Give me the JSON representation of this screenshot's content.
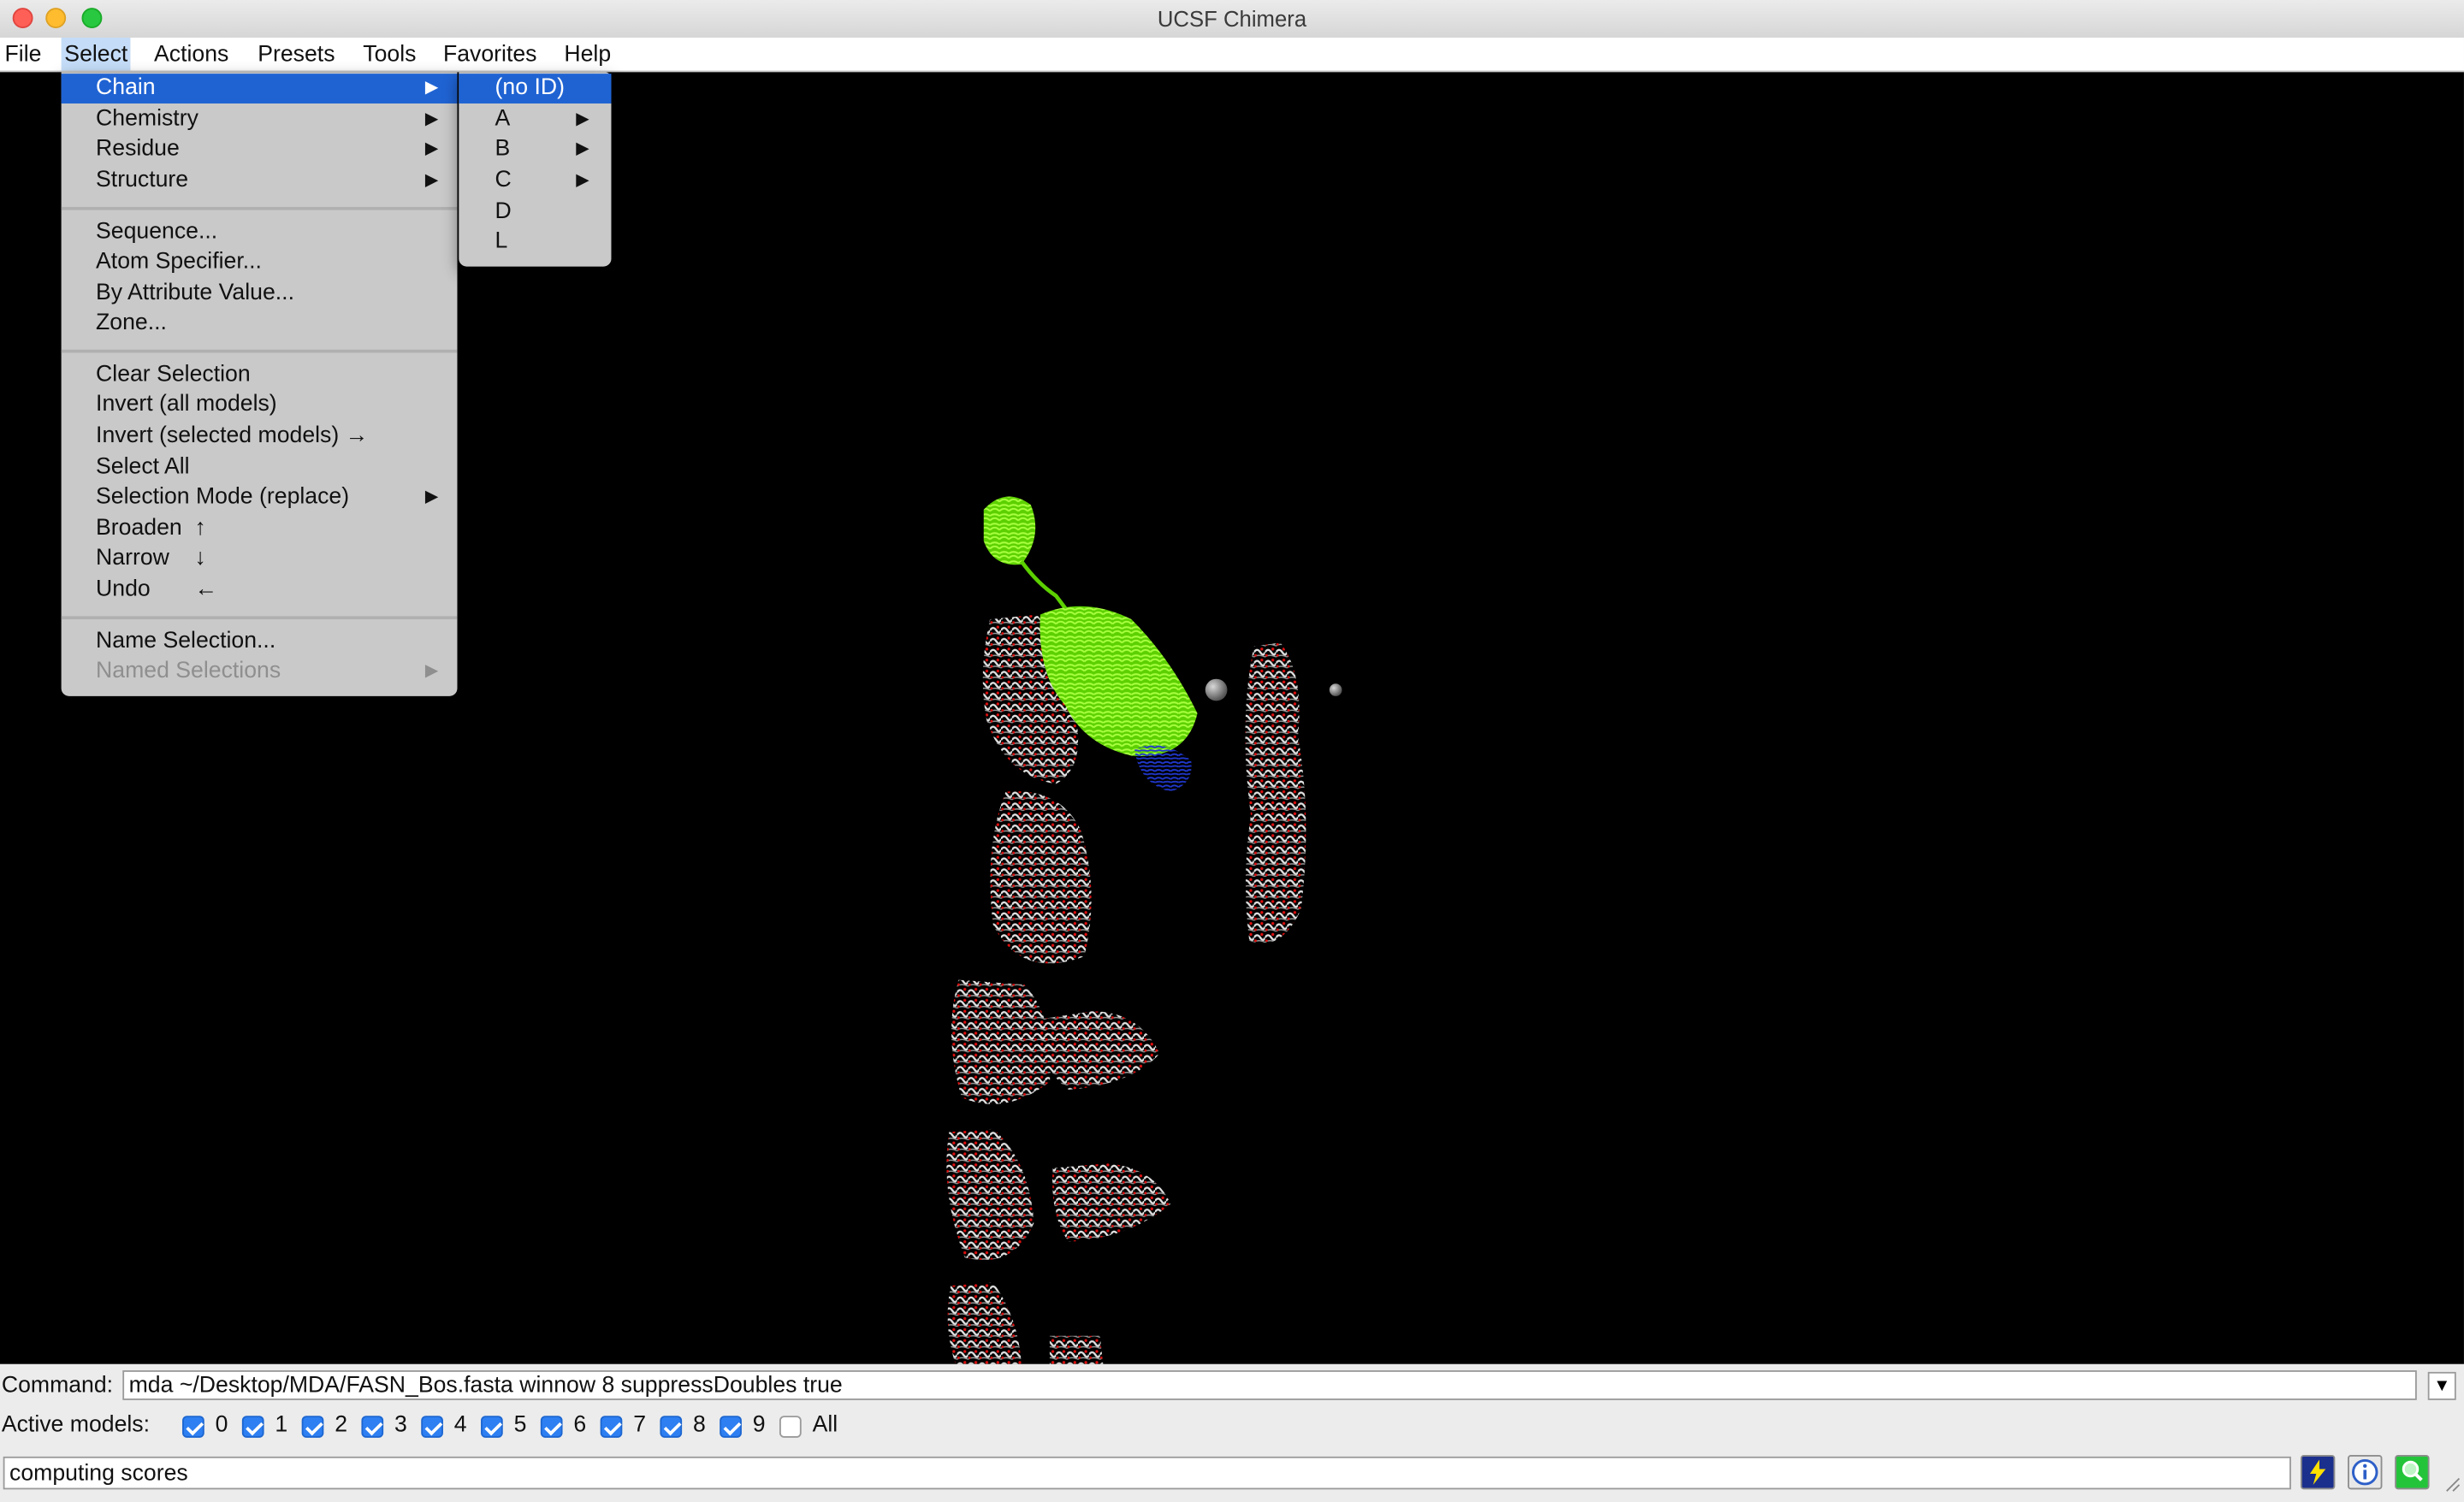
{
  "window": {
    "title": "UCSF Chimera"
  },
  "menubar": {
    "items": [
      "File",
      "Select",
      "Actions",
      "Presets",
      "Tools",
      "Favorites",
      "Help"
    ],
    "active": "Select"
  },
  "select_menu": {
    "items": [
      {
        "label": "Chain",
        "submenu": true,
        "highlighted": true
      },
      {
        "label": "Chemistry",
        "submenu": true
      },
      {
        "label": "Residue",
        "submenu": true
      },
      {
        "label": "Structure",
        "submenu": true
      },
      {
        "label": "Sequence..."
      },
      {
        "label": "Atom Specifier..."
      },
      {
        "label": "By Attribute Value..."
      },
      {
        "label": "Zone..."
      },
      {
        "label": "Clear Selection"
      },
      {
        "label": "Invert (all models)"
      },
      {
        "label": "Invert (selected models) →"
      },
      {
        "label": "Select All"
      },
      {
        "label": "Selection Mode (replace)",
        "submenu": true
      },
      {
        "label": "Broaden  ↑"
      },
      {
        "label": "Narrow    ↓"
      },
      {
        "label": "Undo       ←"
      },
      {
        "label": "Name Selection..."
      },
      {
        "label": "Named Selections",
        "submenu": true,
        "disabled": true
      }
    ]
  },
  "chain_submenu": {
    "items": [
      {
        "label": "(no ID)",
        "highlighted": true
      },
      {
        "label": "A",
        "submenu": true
      },
      {
        "label": "B",
        "submenu": true
      },
      {
        "label": "C",
        "submenu": true
      },
      {
        "label": "D"
      },
      {
        "label": "L"
      }
    ]
  },
  "arrow_glyph": "▶",
  "command": {
    "label": "Command:",
    "value": "mda ~/Desktop/MDA/FASN_Bos.fasta winnow 8 suppressDoubles true",
    "dropdown_glyph": "▼"
  },
  "active_models": {
    "label": "Active models:",
    "models": [
      {
        "label": "0",
        "checked": true
      },
      {
        "label": "1",
        "checked": true
      },
      {
        "label": "2",
        "checked": true
      },
      {
        "label": "3",
        "checked": true
      },
      {
        "label": "4",
        "checked": true
      },
      {
        "label": "5",
        "checked": true
      },
      {
        "label": "6",
        "checked": true
      },
      {
        "label": "7",
        "checked": true
      },
      {
        "label": "8",
        "checked": true
      },
      {
        "label": "9",
        "checked": true
      },
      {
        "label": "All",
        "checked": false
      }
    ]
  },
  "status": {
    "text": "computing scores"
  },
  "colors": {
    "highlight": "#1f63d3",
    "menu_bg": "#c9c9c9",
    "viewer_bg": "#000000",
    "selected_chain": "#7cfc00",
    "ribbon": "#e8e8e8",
    "oxygen": "#e01010",
    "blue_chain": "#1a2ab0"
  },
  "status_icons": [
    "lightning-icon",
    "info-icon",
    "magnifier-icon"
  ]
}
